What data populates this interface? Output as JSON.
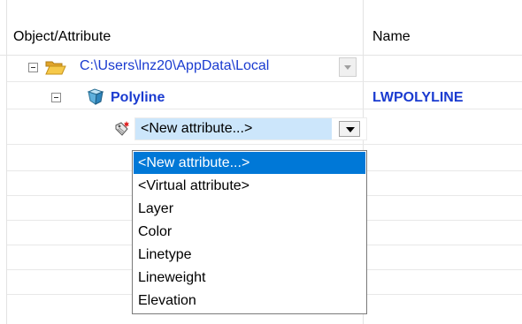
{
  "header": {
    "col1": "Object/Attribute",
    "col2": "Name"
  },
  "tree": {
    "root": {
      "icon": "folder-open-icon",
      "path": "C:\\Users\\lnz20\\AppData\\Local"
    },
    "polyline": {
      "icon": "polyline-object-icon",
      "label": "Polyline",
      "name": "LWPOLYLINE"
    },
    "attribute_row": {
      "icon": "new-attribute-icon",
      "selected": "<New attribute...>"
    }
  },
  "dropdown": {
    "options": [
      "<New attribute...>",
      "<Virtual attribute>",
      "Layer",
      "Color",
      "Linetype",
      "Lineweight",
      "Elevation"
    ],
    "selected_index": 0
  },
  "colors": {
    "link": "#1a3bd0",
    "selection": "#0078d7",
    "edit_highlight": "#cce6fb"
  }
}
